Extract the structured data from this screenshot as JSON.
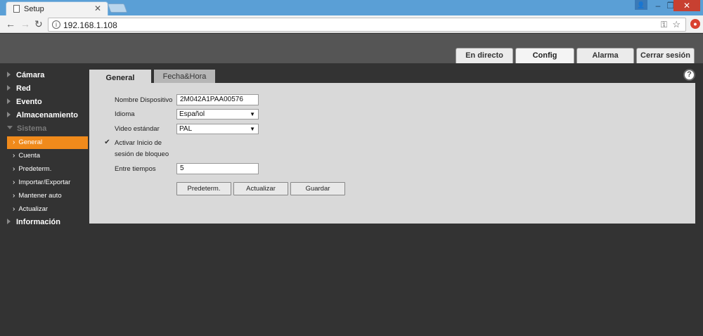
{
  "browser": {
    "tab_title": "Setup",
    "url": "192.168.1.108"
  },
  "main_tabs": [
    {
      "label": "En directo"
    },
    {
      "label": "Config"
    },
    {
      "label": "Alarma"
    },
    {
      "label": "Cerrar sesión"
    }
  ],
  "sidebar": {
    "categories": [
      "Cámara",
      "Red",
      "Evento",
      "Almacenamiento",
      "Sistema",
      "Información"
    ],
    "sistema_items": [
      "General",
      "Cuenta",
      "Predeterm.",
      "Importar/Exportar",
      "Mantener auto",
      "Actualizar"
    ]
  },
  "content_tabs": [
    {
      "label": "General"
    },
    {
      "label": "Fecha&Hora"
    }
  ],
  "form": {
    "device_name_label": "Nombre Dispositivo",
    "device_name_value": "2M042A1PAA00576",
    "language_label": "Idioma",
    "language_value": "Español",
    "video_label": "Video estándar",
    "video_value": "PAL",
    "lock_checkbox_checked": true,
    "lock_label_line1": "Activar Inicio de",
    "lock_label_line2": "sesión de bloqueo",
    "interval_label": "Entre tiempos",
    "interval_value": "5"
  },
  "buttons": {
    "default": "Predeterm.",
    "refresh": "Actualizar",
    "save": "Guardar"
  },
  "colors": {
    "active_item": "#f08a1b",
    "chrome_blue": "#5a9fd6"
  }
}
